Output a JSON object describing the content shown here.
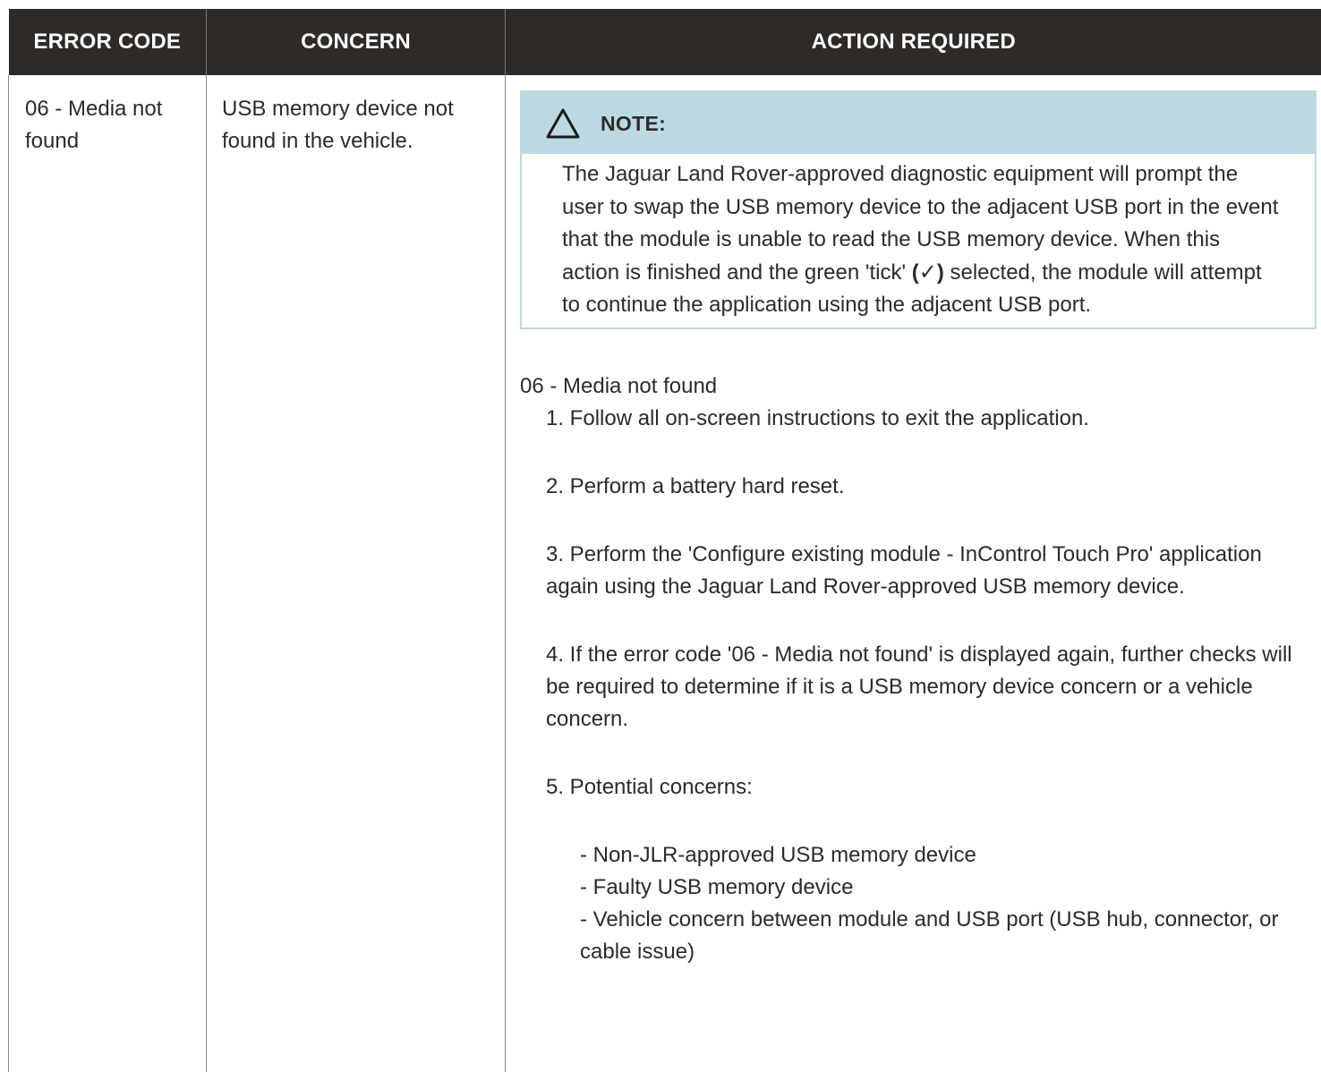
{
  "table": {
    "headers": {
      "error_code": "ERROR CODE",
      "concern": "CONCERN",
      "action_required": "ACTION REQUIRED"
    },
    "row": {
      "error_code": "06 - Media not found",
      "concern": "USB memory device not found in the vehicle.",
      "note": {
        "title": "NOTE:",
        "icon": "warning-triangle-icon",
        "text_before_tick": "The Jaguar Land Rover-approved diagnostic equipment will prompt the user to swap the USB memory device to the adjacent USB port in the event that the module is unable to read the USB memory device. When this action is finished and the green 'tick' ",
        "tick": "(✓)",
        "text_after_tick": " selected, the module will attempt to continue the application using the adjacent USB port."
      },
      "procedure_title": "06 - Media not found",
      "steps": [
        "1. Follow all on-screen instructions to exit the application.",
        "2. Perform a battery hard reset.",
        "3. Perform the 'Configure existing module - InControl Touch Pro' application again using the Jaguar Land Rover-approved USB memory device.",
        "4. If the error code '06 - Media not found' is displayed again, further checks will be required to determine if it is a USB memory device concern or a vehicle concern.",
        "5. Potential concerns:"
      ],
      "potential_concerns": [
        "- Non-JLR-approved USB memory device",
        "- Faulty USB memory device",
        "- Vehicle concern between module and USB port (USB hub, connector, or cable issue)"
      ]
    }
  },
  "colors": {
    "header_bg": "#2d2a27",
    "note_bg": "#bcd9e3",
    "text": "#2b2b2b"
  }
}
